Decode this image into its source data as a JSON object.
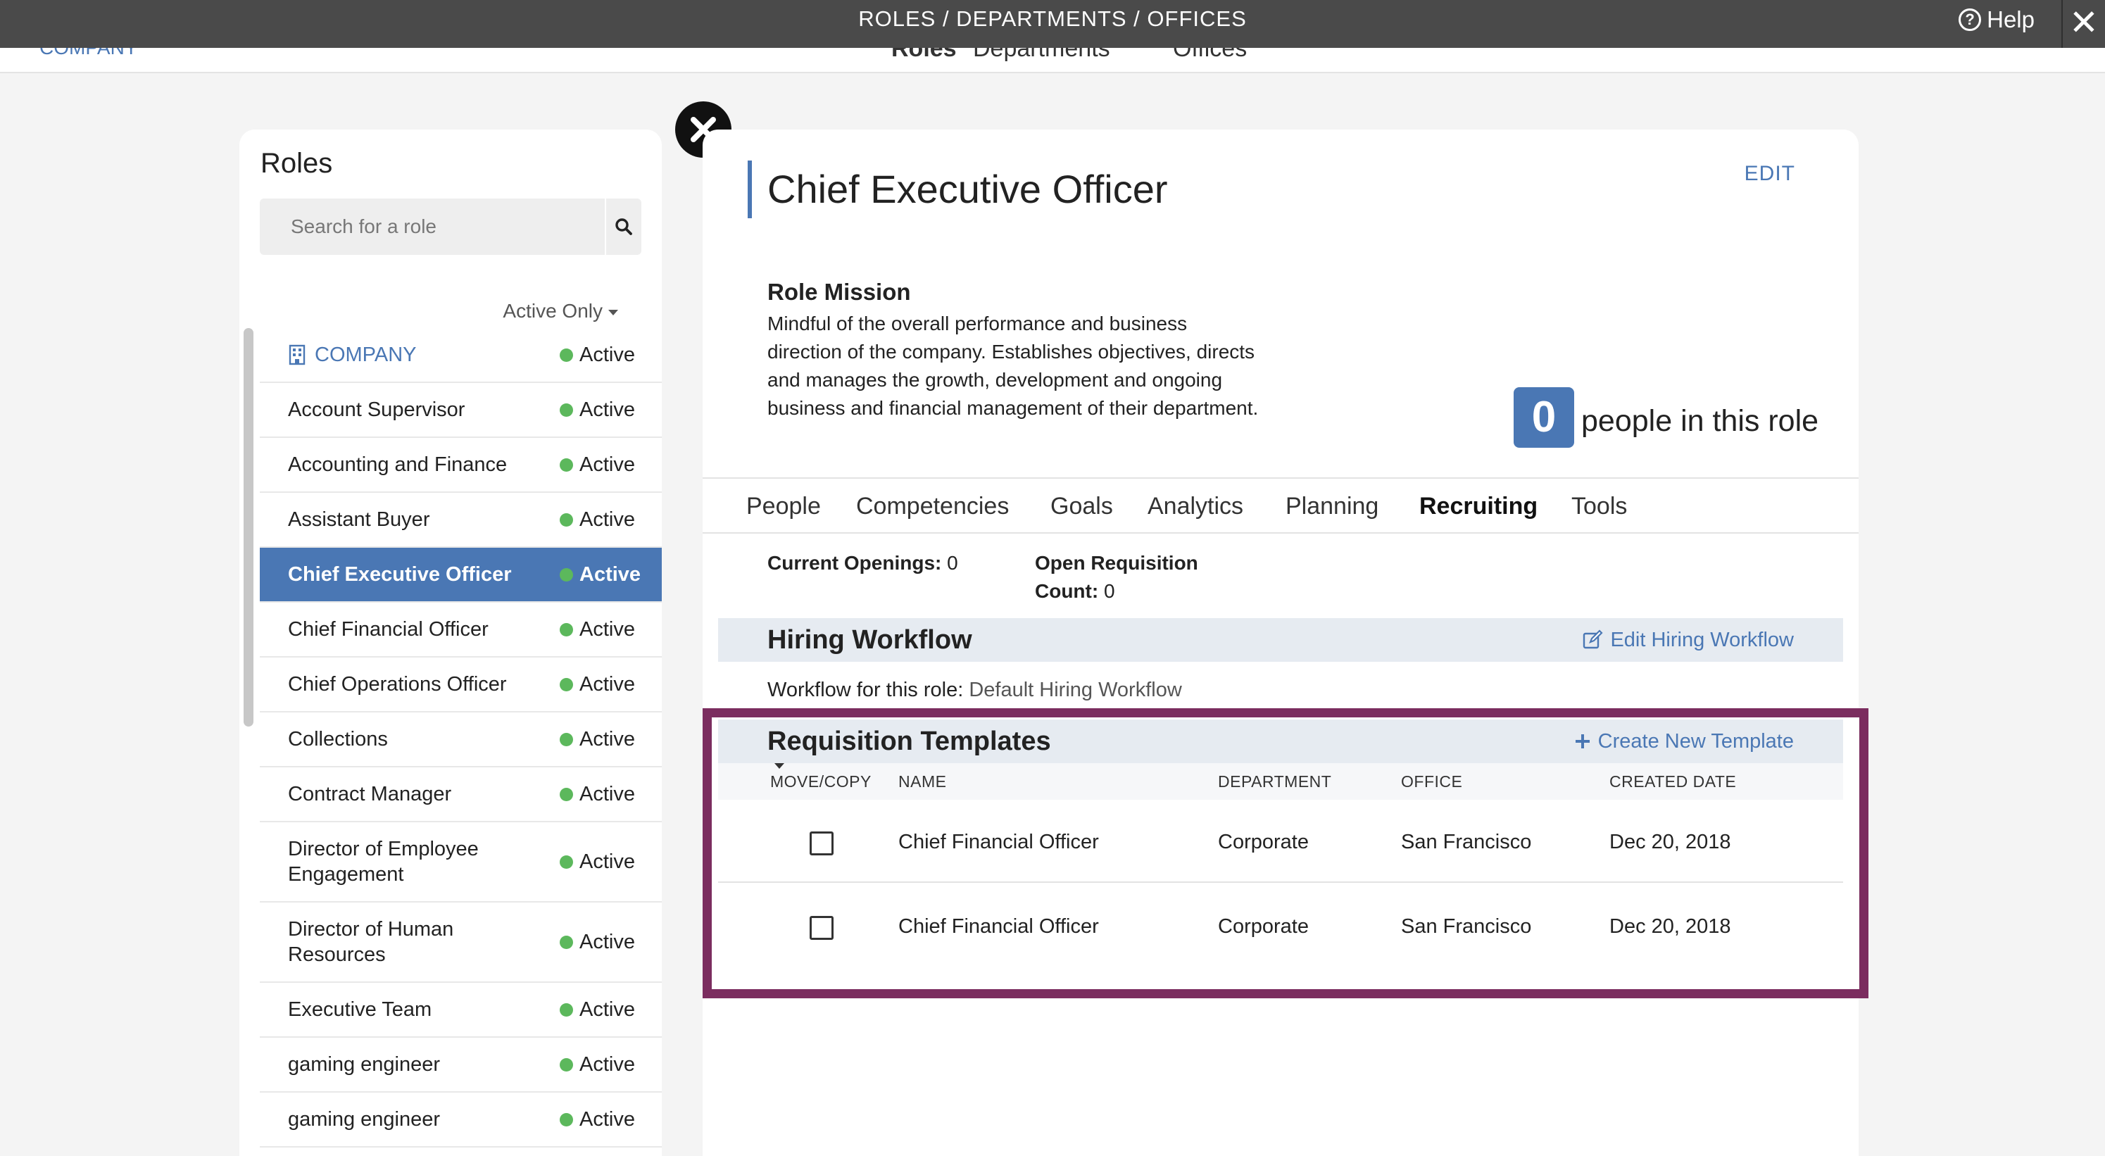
{
  "header": {
    "title": "ROLES / DEPARTMENTS / OFFICES",
    "help_label": "Help",
    "close_glyph": "✕"
  },
  "subnav": {
    "company_label": "COMPANY",
    "tabs": [
      "Roles",
      "Departments",
      "Offices"
    ]
  },
  "roles_panel": {
    "heading": "Roles",
    "search_placeholder": "Search for a role",
    "filter_label": "Active Only",
    "status_label": "Active",
    "items": [
      {
        "name": "COMPANY"
      },
      {
        "name": "Account Supervisor"
      },
      {
        "name": "Accounting and Finance"
      },
      {
        "name": "Assistant Buyer"
      },
      {
        "name": "Chief Executive Officer"
      },
      {
        "name": "Chief Financial Officer"
      },
      {
        "name": "Chief Operations Officer"
      },
      {
        "name": "Collections"
      },
      {
        "name": "Contract Manager"
      },
      {
        "name": "Director of Employee Engagement"
      },
      {
        "name": "Director of Human Resources"
      },
      {
        "name": "Executive Team"
      },
      {
        "name": "gaming engineer"
      },
      {
        "name": "gaming engineer"
      }
    ],
    "selected_index": 4
  },
  "detail": {
    "role_title": "Chief Executive Officer",
    "edit_label": "EDIT",
    "mission_heading": "Role Mission",
    "mission_text": "Mindful of the overall performance and business direction of the company. Establishes objectives, directs and manages the growth, development and ongoing business and financial management of their department.",
    "people_count": "0",
    "people_label": "people in this role",
    "tabs": [
      "People",
      "Competencies",
      "Goals",
      "Analytics",
      "Planning",
      "Recruiting",
      "Tools"
    ],
    "active_tab": "Recruiting",
    "current_openings_label": "Current Openings:",
    "current_openings_value": "0",
    "open_req_label_1": "Open Requisition",
    "open_req_label_2": "Count:",
    "open_req_value": "0",
    "hiring_workflow": {
      "heading": "Hiring Workflow",
      "action_label": "Edit Hiring Workflow",
      "workflow_label": "Workflow for this role:",
      "workflow_value": "Default Hiring Workflow"
    },
    "requisition_templates": {
      "heading": "Requisition Templates",
      "action_label": "Create New Template",
      "columns": [
        "MOVE/COPY",
        "NAME",
        "DEPARTMENT",
        "OFFICE",
        "CREATED DATE"
      ],
      "rows": [
        {
          "name": "Chief Financial Officer",
          "department": "Corporate",
          "office": "San Francisco",
          "created": "Dec 20, 2018"
        },
        {
          "name": "Chief Financial Officer",
          "department": "Corporate",
          "office": "San Francisco",
          "created": "Dec 20, 2018"
        }
      ]
    }
  },
  "colors": {
    "accent": "#4a77b4",
    "header_bg": "#4a4a4a",
    "status_green": "#5cb85c",
    "highlight_frame": "#7b2d5f"
  }
}
